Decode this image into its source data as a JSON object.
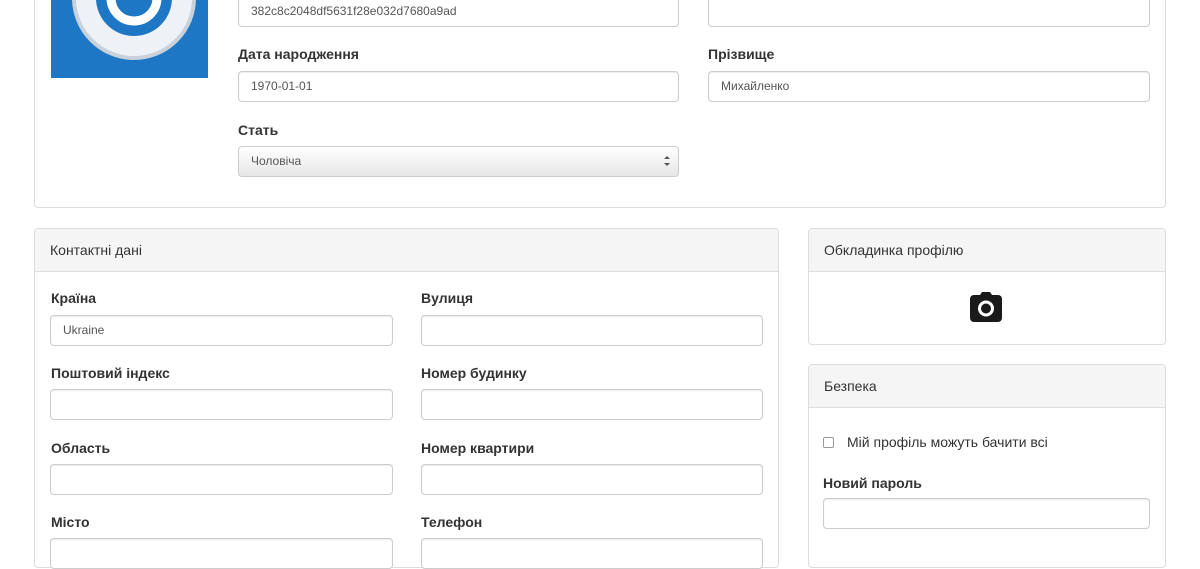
{
  "profile": {
    "id_value": "382c8c2048df5631f28e032d7680a9ad",
    "first_name_value": "",
    "birth_date_label": "Дата народження",
    "birth_date_value": "1970-01-01",
    "surname_label": "Прізвище",
    "surname_value": "Михайленко",
    "gender_label": "Стать",
    "gender_selected": "Чоловіча"
  },
  "contacts": {
    "title": "Контактні дані",
    "country_label": "Країна",
    "country_value": "Ukraine",
    "street_label": "Вулиця",
    "street_value": "",
    "postal_label": "Поштовий індекс",
    "postal_value": "",
    "house_label": "Номер будинку",
    "house_value": "",
    "region_label": "Область",
    "region_value": "",
    "apartment_label": "Номер квартири",
    "apartment_value": "",
    "city_label": "Місто",
    "city_value": "",
    "phone_label": "Телефон",
    "phone_value": ""
  },
  "cover": {
    "title": "Обкладинка профілю",
    "icon": "camera-icon"
  },
  "security": {
    "title": "Безпека",
    "public_profile_label": "Мій профіль можуть бачити всі",
    "public_profile_checked": false,
    "new_password_label": "Новий пароль",
    "new_password_value": ""
  },
  "colors": {
    "avatar_bg": "#1d77c4",
    "panel_heading_bg": "#f5f5f5",
    "border": "#dddddd"
  }
}
